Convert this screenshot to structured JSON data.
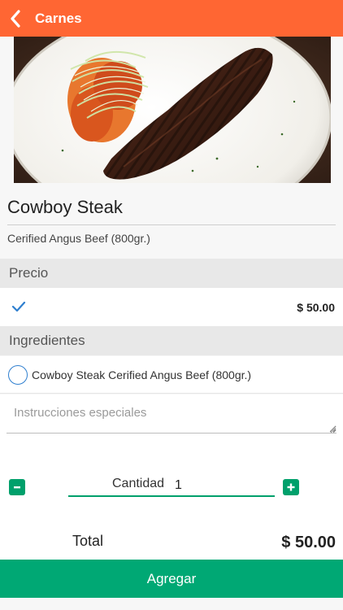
{
  "header": {
    "title": "Carnes",
    "back_icon": "chevron-left-icon",
    "background_color": "#ff6633"
  },
  "product": {
    "image_alt": "Cowboy Steak",
    "name": "Cowboy Steak",
    "description": "Cerified Angus Beef (800gr.)"
  },
  "price_section": {
    "header": "Precio",
    "selected": true,
    "value": "$ 50.00"
  },
  "ingredients_section": {
    "header": "Ingredientes",
    "items": [
      {
        "label": "Cowboy Steak Cerified Angus Beef (800gr.)",
        "selected": false
      }
    ]
  },
  "instructions": {
    "placeholder": "Instrucciones especiales",
    "value": ""
  },
  "quantity": {
    "label": "Cantidad",
    "value": "1"
  },
  "total": {
    "label": "Total",
    "value": "$ 50.00"
  },
  "actions": {
    "add_label": "Agregar",
    "accent_color": "#00a874"
  }
}
